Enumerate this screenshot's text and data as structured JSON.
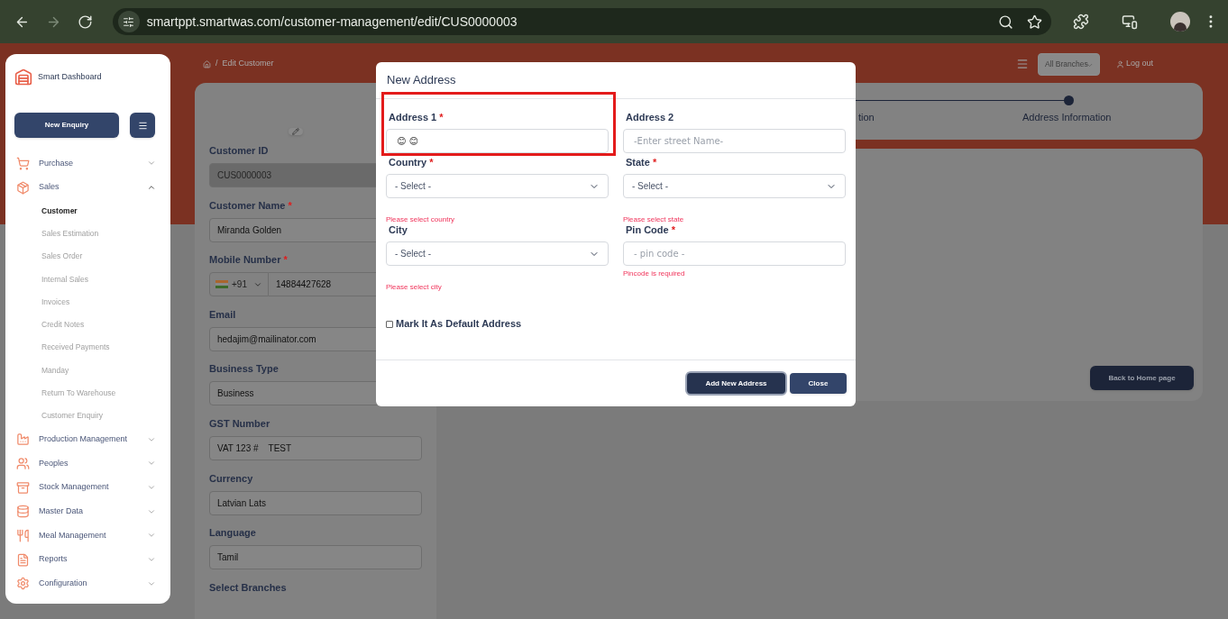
{
  "browser": {
    "url": "smartppt.smartwas.com/customer-management/edit/CUS0000003",
    "nav": [
      {
        "kind": "back",
        "disabled": false
      },
      {
        "kind": "forward",
        "disabled": true
      },
      {
        "kind": "reload",
        "disabled": false
      }
    ]
  },
  "sidebar": {
    "brand": "Smart Dashboard",
    "new_enquiry": "New Enquiry",
    "items": [
      {
        "label": "Purchase",
        "expanded": false
      },
      {
        "label": "Sales",
        "expanded": true,
        "children": [
          {
            "label": "Customer",
            "selected": true
          },
          {
            "label": "Sales Estimation",
            "selected": false
          },
          {
            "label": "Sales Order",
            "selected": false
          },
          {
            "label": "Internal Sales",
            "selected": false
          },
          {
            "label": "Invoices",
            "selected": false
          },
          {
            "label": "Credit Notes",
            "selected": false
          },
          {
            "label": "Received Payments",
            "selected": false
          },
          {
            "label": "Manday",
            "selected": false
          },
          {
            "label": "Return To Warehouse",
            "selected": false
          },
          {
            "label": "Customer Enquiry",
            "selected": false
          }
        ]
      },
      {
        "label": "Production Management",
        "expanded": false
      },
      {
        "label": "Peoples",
        "expanded": false
      },
      {
        "label": "Stock Management",
        "expanded": false
      },
      {
        "label": "Master Data",
        "expanded": false
      },
      {
        "label": "Meal Management",
        "expanded": false
      },
      {
        "label": "Reports",
        "expanded": false
      },
      {
        "label": "Configuration",
        "expanded": false
      }
    ]
  },
  "header": {
    "breadcrumb_separator": "/",
    "breadcrumb": [
      "Edit Customer"
    ],
    "branch_select": "All Branches",
    "logout": "Log out"
  },
  "customer_form": {
    "fields": [
      {
        "kind": "text",
        "label": "Customer ID",
        "value": "CUS0000003",
        "disabled": true
      },
      {
        "kind": "text",
        "label": "Customer Name",
        "required_mark": "*",
        "value": "Miranda Golden",
        "disabled": false
      },
      {
        "kind": "phone",
        "label": "Mobile Number",
        "required_mark": "*",
        "country_code": "+91",
        "value": "14884427628"
      },
      {
        "kind": "text",
        "label": "Email",
        "value": "hedajim@mailinator.com",
        "disabled": false
      },
      {
        "kind": "text",
        "label": "Business Type",
        "value": "Business",
        "disabled": false
      },
      {
        "kind": "text",
        "label": "GST Number",
        "value": "VAT 123 #    TEST",
        "disabled": false
      },
      {
        "kind": "text",
        "label": "Currency",
        "value": "Latvian Lats",
        "disabled": false
      },
      {
        "kind": "text",
        "label": "Language",
        "value": "Tamil",
        "disabled": false
      },
      {
        "kind": "label",
        "label": "Select Branches"
      }
    ]
  },
  "stepper": {
    "steps": [
      "tion",
      "Address Information"
    ]
  },
  "back_button": "Back to Home page",
  "modal": {
    "title": "New Address",
    "fields": [
      {
        "kind": "input",
        "label": "Address 1",
        "required_mark": "*",
        "value": "😊 😊",
        "highlighted": true
      },
      {
        "kind": "input",
        "label": "Address 2",
        "placeholder": "-Enter street Name-"
      },
      {
        "kind": "select",
        "label": "Country",
        "required_mark": "*",
        "value": "- Select -",
        "error": "Please select country"
      },
      {
        "kind": "select",
        "label": "State",
        "required_mark": "*",
        "value": "- Select -",
        "error": "Please select state"
      },
      {
        "kind": "select",
        "label": "City",
        "value": "- Select -",
        "error": "Please select city"
      },
      {
        "kind": "input",
        "label": "Pin Code",
        "required_mark": "*",
        "placeholder": "- pin code -",
        "error": "Pincode is required"
      }
    ],
    "default_checkbox": {
      "label": "Mark It As Default Address",
      "checked": false
    },
    "buttons": [
      {
        "label": "Add New Address",
        "focused": true
      },
      {
        "label": "Close",
        "focused": false
      }
    ]
  }
}
